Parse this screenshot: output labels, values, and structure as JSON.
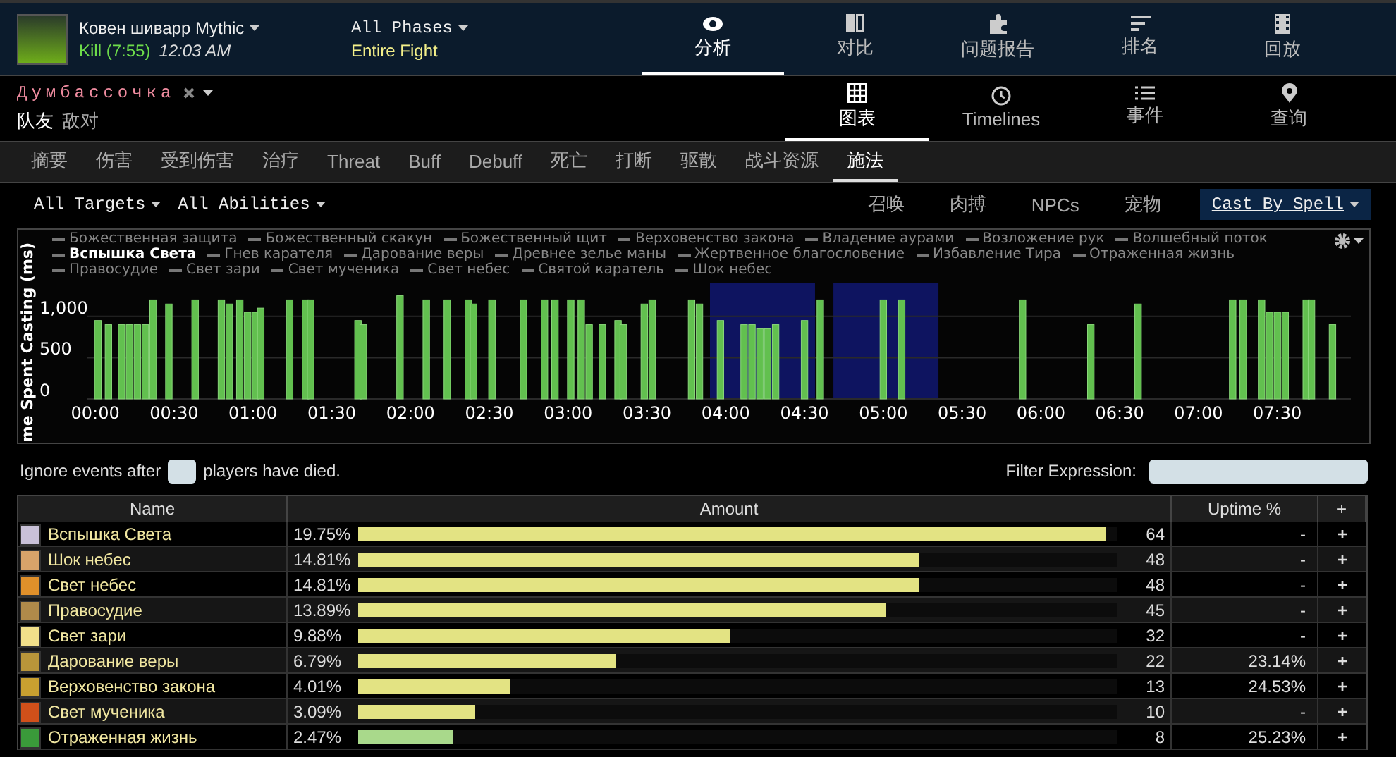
{
  "encounter": {
    "title": "Ковен шиварр Mythic",
    "result": "Kill (7:55)",
    "time": "12:03 AM",
    "phase": "All Phases",
    "phase_value": "Entire Fight"
  },
  "main_nav": [
    {
      "label": "分析",
      "selected": true
    },
    {
      "label": "对比",
      "selected": false
    },
    {
      "label": "问题报告",
      "selected": false
    },
    {
      "label": "排名",
      "selected": false
    },
    {
      "label": "回放",
      "selected": false
    }
  ],
  "player": {
    "name": "Думбассочка",
    "filters": [
      {
        "label": "队友",
        "selected": true
      },
      {
        "label": "敌对",
        "selected": false
      }
    ]
  },
  "view_nav": [
    {
      "label": "图表",
      "selected": true
    },
    {
      "label": "Timelines",
      "selected": false
    },
    {
      "label": "事件",
      "selected": false
    },
    {
      "label": "查询",
      "selected": false
    }
  ],
  "tabs": [
    {
      "label": "摘要",
      "selected": false
    },
    {
      "label": "伤害",
      "selected": false
    },
    {
      "label": "受到伤害",
      "selected": false
    },
    {
      "label": "治疗",
      "selected": false
    },
    {
      "label": "Threat",
      "selected": false
    },
    {
      "label": "Buff",
      "selected": false
    },
    {
      "label": "Debuff",
      "selected": false
    },
    {
      "label": "死亡",
      "selected": false
    },
    {
      "label": "打断",
      "selected": false
    },
    {
      "label": "驱散",
      "selected": false
    },
    {
      "label": "战斗资源",
      "selected": false
    },
    {
      "label": "施法",
      "selected": true
    }
  ],
  "filters": {
    "targets": "All Targets",
    "abilities": "All Abilities",
    "groups": [
      "召唤",
      "肉搏",
      "NPCs",
      "宠物"
    ],
    "mode": "Cast By Spell"
  },
  "chart": {
    "legend": [
      {
        "label": "Божественная защита",
        "highlighted": false
      },
      {
        "label": "Божественный скакун",
        "highlighted": false
      },
      {
        "label": "Божественный щит",
        "highlighted": false
      },
      {
        "label": "Верховенство закона",
        "highlighted": false
      },
      {
        "label": "Владение аурами",
        "highlighted": false
      },
      {
        "label": "Возложение рук",
        "highlighted": false
      },
      {
        "label": "Волшебный поток",
        "highlighted": false
      },
      {
        "label": "Вспышка Света",
        "highlighted": true
      },
      {
        "label": "Гнев карателя",
        "highlighted": false
      },
      {
        "label": "Дарование веры",
        "highlighted": false
      },
      {
        "label": "Древнее зелье маны",
        "highlighted": false
      },
      {
        "label": "Жертвенное благословение",
        "highlighted": false
      },
      {
        "label": "Избавление Тира",
        "highlighted": false
      },
      {
        "label": "Отраженная жизнь",
        "highlighted": false
      },
      {
        "label": "Правосудие",
        "highlighted": false
      },
      {
        "label": "Свет зари",
        "highlighted": false
      },
      {
        "label": "Свет мученика",
        "highlighted": false
      },
      {
        "label": "Свет небес",
        "highlighted": false
      },
      {
        "label": "Святой каратель",
        "highlighted": false
      },
      {
        "label": "Шок небес",
        "highlighted": false
      }
    ],
    "chart_data": {
      "type": "bar",
      "ylabel": "me Spent Casting (ms)",
      "x": [
        1,
        5,
        10,
        13,
        16,
        19,
        22,
        28,
        38,
        48,
        51,
        55,
        58,
        61,
        63,
        74,
        80,
        82,
        100,
        102,
        116,
        126,
        134,
        142,
        144,
        151,
        163,
        171,
        175,
        181,
        185,
        188,
        193,
        199,
        201,
        209,
        212,
        227,
        230,
        238,
        247,
        250,
        253,
        256,
        259,
        270,
        276,
        300,
        307,
        353,
        379,
        397,
        433,
        437,
        444,
        447,
        450,
        453,
        461,
        463,
        471
      ],
      "values": [
        950,
        900,
        900,
        900,
        900,
        900,
        1200,
        1150,
        1200,
        1200,
        1150,
        1200,
        1050,
        1050,
        1100,
        1200,
        1200,
        1200,
        950,
        900,
        1250,
        1200,
        1200,
        1200,
        1150,
        1200,
        1200,
        1200,
        1200,
        1200,
        1200,
        900,
        900,
        950,
        900,
        1150,
        1200,
        1200,
        1150,
        950,
        900,
        900,
        850,
        850,
        900,
        950,
        1200,
        1200,
        1200,
        1200,
        900,
        1150,
        1200,
        1200,
        1200,
        1050,
        1050,
        1050,
        1200,
        1200,
        900
      ],
      "xlim": [
        -3,
        478
      ],
      "ylim": [
        0,
        1400
      ],
      "xticks": [
        {
          "value": 0,
          "label": "00:00"
        },
        {
          "value": 30,
          "label": "00:30"
        },
        {
          "value": 60,
          "label": "01:00"
        },
        {
          "value": 90,
          "label": "01:30"
        },
        {
          "value": 120,
          "label": "02:00"
        },
        {
          "value": 150,
          "label": "02:30"
        },
        {
          "value": 180,
          "label": "03:00"
        },
        {
          "value": 210,
          "label": "03:30"
        },
        {
          "value": 240,
          "label": "04:00"
        },
        {
          "value": 270,
          "label": "04:30"
        },
        {
          "value": 300,
          "label": "05:00"
        },
        {
          "value": 330,
          "label": "05:30"
        },
        {
          "value": 360,
          "label": "06:00"
        },
        {
          "value": 390,
          "label": "06:30"
        },
        {
          "value": 420,
          "label": "07:00"
        },
        {
          "value": 450,
          "label": "07:30"
        }
      ],
      "yticks": [
        {
          "value": 0,
          "label": "0"
        },
        {
          "value": 500,
          "label": "500"
        },
        {
          "value": 1000,
          "label": "1,000"
        }
      ],
      "bands": [
        {
          "axis": "x",
          "from": 234,
          "to": 274
        },
        {
          "axis": "x",
          "from": 281,
          "to": 321
        }
      ]
    }
  },
  "ignore": {
    "before": "Ignore events after",
    "after": "players have died."
  },
  "filter_expression": {
    "label": "Filter Expression:"
  },
  "table": {
    "columns": [
      "Name",
      "Amount",
      "Uptime %",
      "+"
    ],
    "rows": [
      {
        "name": "Вспышка Света",
        "percent": "19.75%",
        "level": 0.985,
        "count": "64",
        "uptime": "-",
        "color": "#e3e383"
      },
      {
        "name": "Шок небес",
        "percent": "14.81%",
        "level": 0.74,
        "count": "48",
        "uptime": "-",
        "color": "#e3e383"
      },
      {
        "name": "Свет небес",
        "percent": "14.81%",
        "level": 0.74,
        "count": "48",
        "uptime": "-",
        "color": "#e3e383"
      },
      {
        "name": "Правосудие",
        "percent": "13.89%",
        "level": 0.695,
        "count": "45",
        "uptime": "-",
        "color": "#e3e383"
      },
      {
        "name": "Свет зари",
        "percent": "9.88%",
        "level": 0.49,
        "count": "32",
        "uptime": "-",
        "color": "#e3e383"
      },
      {
        "name": "Дарование веры",
        "percent": "6.79%",
        "level": 0.34,
        "count": "22",
        "uptime": "23.14%",
        "color": "#e3e383"
      },
      {
        "name": "Верховенство закона",
        "percent": "4.01%",
        "level": 0.2,
        "count": "13",
        "uptime": "24.53%",
        "color": "#e3e383"
      },
      {
        "name": "Свет мученика",
        "percent": "3.09%",
        "level": 0.155,
        "count": "10",
        "uptime": "-",
        "color": "#e3e383"
      },
      {
        "name": "Отраженная жизнь",
        "percent": "2.47%",
        "level": 0.124,
        "count": "8",
        "uptime": "25.23%",
        "color": "#a9d98b"
      }
    ]
  }
}
